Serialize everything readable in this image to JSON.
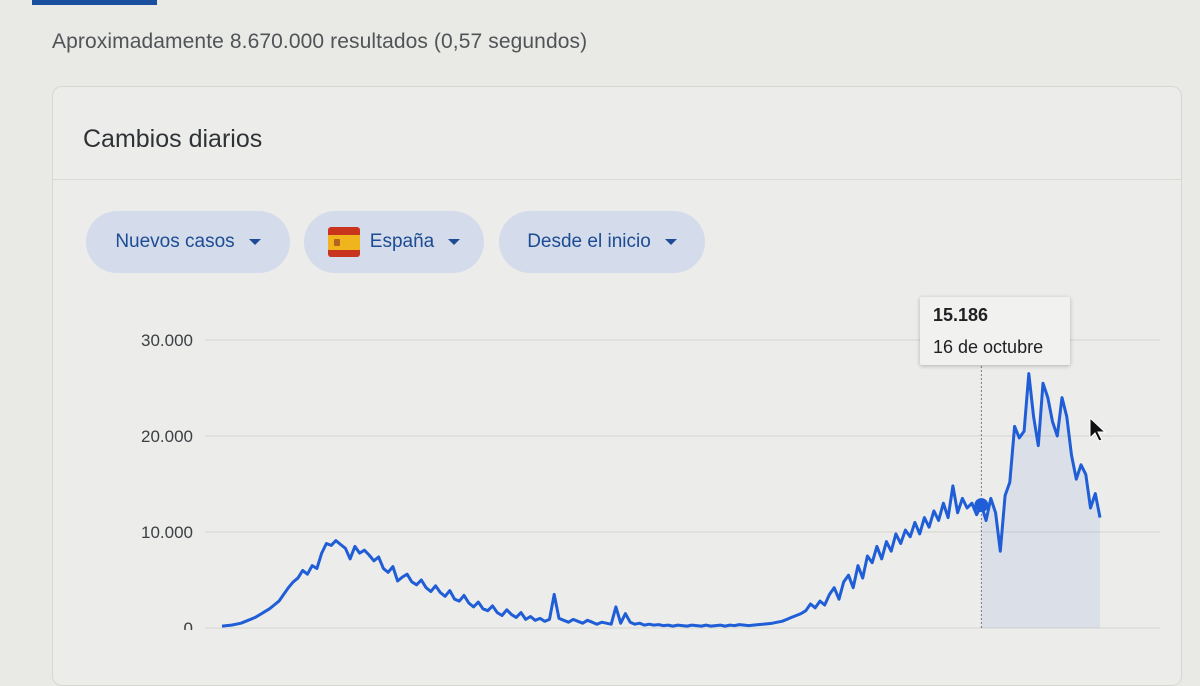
{
  "result_stats": "Aproximadamente 8.670.000 resultados (0,57 segundos)",
  "card": {
    "title": "Cambios diarios",
    "filters": [
      {
        "label": "Nuevos casos"
      },
      {
        "label": "España",
        "icon": "spain-flag-icon"
      },
      {
        "label": "Desde el inicio"
      }
    ]
  },
  "tooltip": {
    "value": "15.186",
    "date": "16 de octubre"
  },
  "colors": {
    "line": "#1f5ed6",
    "chip_text": "#1c4c94",
    "chip_bg": "#d4dbea"
  },
  "chart_data": {
    "type": "line",
    "y_ticks": [
      "30.000",
      "20.000",
      "10.000",
      "0"
    ],
    "ylim": [
      0,
      30000
    ],
    "grid": true,
    "highlight_index": 160,
    "series": [
      {
        "values": [
          200,
          250,
          300,
          400,
          500,
          700,
          900,
          1100,
          1400,
          1700,
          2000,
          2400,
          2800,
          3500,
          4200,
          4800,
          5200,
          6000,
          5600,
          6500,
          6200,
          7800,
          8800,
          8600,
          9100,
          8700,
          8300,
          7200,
          8500,
          7800,
          8100,
          7600,
          7000,
          7400,
          6200,
          5800,
          6400,
          4900,
          5300,
          5600,
          4800,
          4500,
          5000,
          4200,
          3800,
          4400,
          3700,
          3300,
          3900,
          3000,
          2800,
          3400,
          2600,
          2200,
          2700,
          2000,
          1800,
          2300,
          1600,
          1300,
          1900,
          1400,
          1100,
          1600,
          900,
          1200,
          800,
          1000,
          700,
          900,
          3500,
          1000,
          800,
          600,
          900,
          700,
          500,
          800,
          600,
          400,
          600,
          500,
          400,
          2200,
          500,
          1500,
          600,
          400,
          500,
          300,
          400,
          300,
          350,
          250,
          300,
          200,
          300,
          250,
          200,
          300,
          250,
          200,
          300,
          200,
          250,
          300,
          200,
          300,
          250,
          350,
          300,
          250,
          300,
          350,
          400,
          450,
          500,
          600,
          700,
          900,
          1100,
          1300,
          1500,
          1800,
          2500,
          2100,
          2800,
          2400,
          3500,
          4200,
          3000,
          4800,
          5500,
          4200,
          6500,
          5200,
          7500,
          6800,
          8500,
          7200,
          9000,
          8000,
          9800,
          8800,
          10200,
          9500,
          11000,
          9800,
          11500,
          10500,
          12200,
          11200,
          13000,
          11500,
          14800,
          12000,
          13500,
          12500,
          13000,
          11800,
          12800,
          11200,
          13500,
          12000,
          8000,
          13800,
          15186,
          21000,
          19800,
          20500,
          26500,
          22000,
          19000,
          25500,
          24000,
          21500,
          20000,
          24000,
          22000,
          18000,
          15500,
          17000,
          16000,
          12500,
          14000,
          11500
        ]
      }
    ]
  }
}
